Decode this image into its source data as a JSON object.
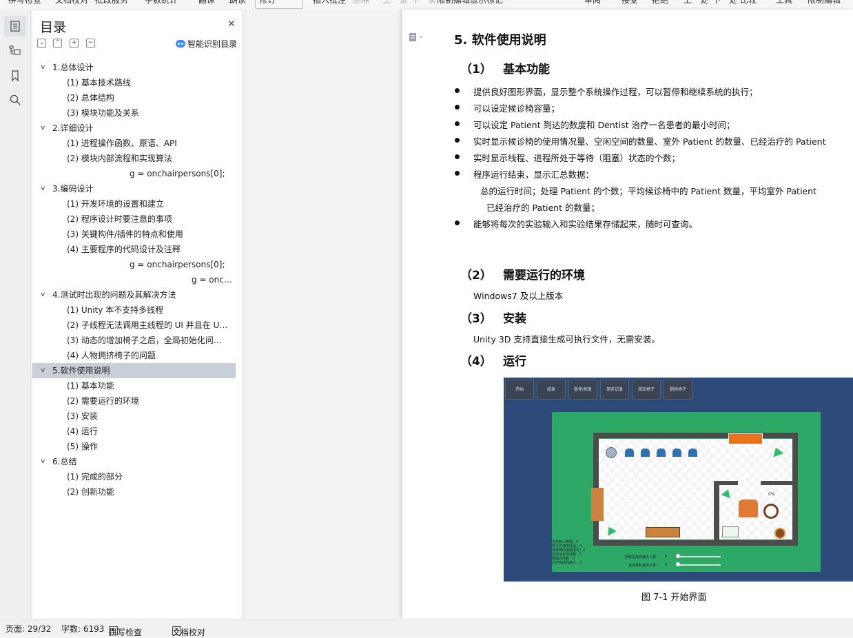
{
  "topbar": {
    "items": [
      "拼写检查",
      "文档校对",
      "批改服务",
      "字数统计",
      "翻译",
      "朗读",
      "修订",
      "插入批注",
      "删除",
      "上一条",
      "下一条",
      "限制编辑",
      "显示标记",
      "审阅",
      "接受",
      "拒绝",
      "上一处",
      "下一处",
      "比较",
      "工具",
      "限制编辑"
    ]
  },
  "sidebar_rail": {
    "icons": [
      "toc-icon",
      "nav-pane-icon",
      "bookmark-icon",
      "search-icon"
    ]
  },
  "toc": {
    "title": "目录",
    "smart_toc_label": "智能识别目录",
    "items": [
      {
        "label": "1.总体设计",
        "level": 1,
        "expanded": true
      },
      {
        "label": "(1)  基本技术路线",
        "level": 2
      },
      {
        "label": "(2)  总体结构",
        "level": 2
      },
      {
        "label": "(3)  模块功能及关系",
        "level": 2
      },
      {
        "label": "2.详细设计",
        "level": 1,
        "expanded": true
      },
      {
        "label": "(1)  进程操作函数、原语、API",
        "level": 2
      },
      {
        "label": "(2)  模块内部流程和实现算法",
        "level": 2
      },
      {
        "label": "g = onchairpersons[0];",
        "level": 3
      },
      {
        "label": "3.编码设计",
        "level": 1,
        "expanded": true
      },
      {
        "label": "(1)  开发环境的设置和建立",
        "level": 2
      },
      {
        "label": "(2)  程序设计时要注意的事项",
        "level": 2
      },
      {
        "label": "(3)  关键构件/插件的特点和使用",
        "level": 2
      },
      {
        "label": "(4)  主要程序的代码设计及注释",
        "level": 2
      },
      {
        "label": "g = onchairpersons[0];",
        "level": 3
      },
      {
        "label": "g = onc…",
        "level": 4
      },
      {
        "label": "4.测试时出现的问题及其解决方法",
        "level": 1,
        "expanded": true
      },
      {
        "label": "(1)    Unity 本不支持多线程",
        "level": 2
      },
      {
        "label": "(2)  子线程无法调用主线程的 UI 并且在 U…",
        "level": 2
      },
      {
        "label": "(3)    动态的增加椅子之后，全局初始化问…",
        "level": 2
      },
      {
        "label": "(4)  人物拥挤椅子的问题",
        "level": 2
      },
      {
        "label": "5.软件使用说明",
        "level": 1,
        "expanded": true,
        "selected": true
      },
      {
        "label": "(1)  基本功能",
        "level": 2
      },
      {
        "label": "(2)  需要运行的环境",
        "level": 2
      },
      {
        "label": "(3)  安装",
        "level": 2
      },
      {
        "label": "(4)  运行",
        "level": 2
      },
      {
        "label": "(5)  操作",
        "level": 2
      },
      {
        "label": "6.总结",
        "level": 1,
        "expanded": true
      },
      {
        "label": "(1)  完成的部分",
        "level": 2
      },
      {
        "label": "(2)  创新功能",
        "level": 2
      }
    ]
  },
  "document": {
    "heading": "5. 软件使用说明",
    "sections": [
      {
        "num": "（1）",
        "title": "基本功能"
      },
      {
        "num": "（2）",
        "title": "需要运行的环境"
      },
      {
        "num": "（3）",
        "title": "安装"
      },
      {
        "num": "（4）",
        "title": "运行"
      }
    ],
    "bullets": [
      "提供良好图形界面，显示整个系统操作过程，可以暂停和继续系统的执行；",
      "可以设定候诊椅容量；",
      "可以设定 Patient 到达的数度和 Dentist 治疗一名患者的最小时间；",
      "实时显示候诊椅的使用情况量、空闲空间的数量、室外 Patient 的数量、已经治疗的 Patient",
      "实时显示线程、进程所处于等待（阻塞）状态的个数；",
      "程序运行结束，显示汇总数据：",
      "能够将每次的实验输入和实验结果存储起来，随时可查询。"
    ],
    "summary_line1": "总的运行时间；处理 Patient 的个数；平均候诊椅中的 Patient 数量，平均室外 Patient",
    "summary_line2": "已经治疗的 Patient 的数量；",
    "env_text": "Windows7 及以上版本",
    "install_text": "Unity 3D 支持直接生成可执行文件，无需安装。",
    "figure": {
      "buttons": [
        "开始",
        "结束",
        "暂停/恢复",
        "保存记录",
        "增加椅子",
        "删除椅子"
      ],
      "percent": "0%",
      "stats": [
        "当前病人数量：0",
        "椅子的使用情况：0",
        "等待椅的使用情况：0",
        "当前运行的线程：0",
        "阻塞的线程：0",
        "治疗完成的病人：0"
      ],
      "slider1": "随机生成的最大人数：",
      "slider2": "室外排队最大人数：",
      "slider1_value": "0",
      "slider2_value": "0"
    },
    "caption": "图 7-1  开始界面"
  },
  "statusbar": {
    "page": "页面: 29/32",
    "words": "字数: 6193",
    "spell": "拼写检查",
    "proof": "文档校对"
  }
}
